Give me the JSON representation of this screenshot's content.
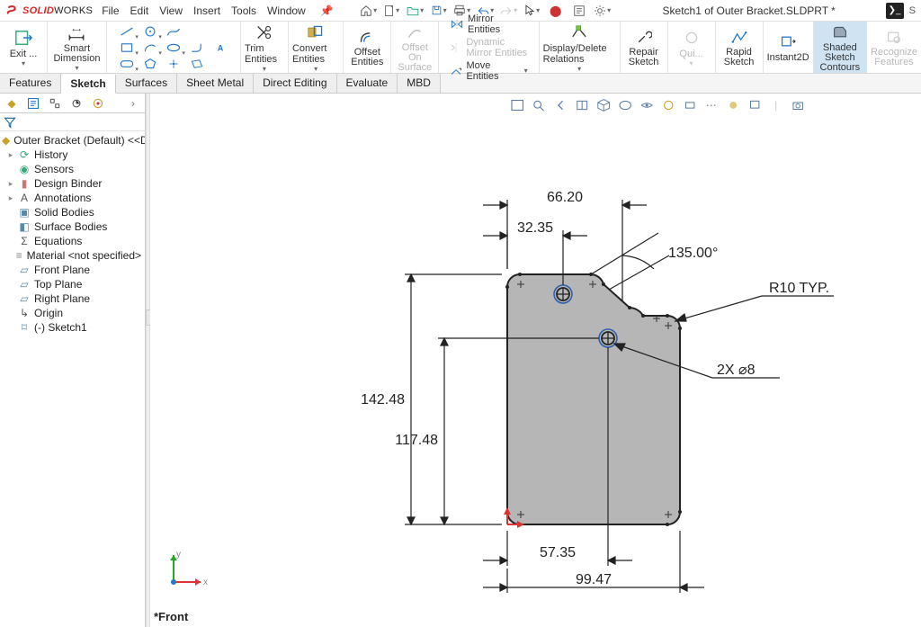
{
  "brand": {
    "solid": "SOLID",
    "works": "WORKS"
  },
  "menubar": [
    "File",
    "Edit",
    "View",
    "Insert",
    "Tools",
    "Window"
  ],
  "title": "Sketch1 of Outer Bracket.SLDPRT *",
  "search_placeholder": "Search",
  "ribbon": {
    "exit": "Exit ...",
    "smart_dim": "Smart Dimension",
    "trim": "Trim Entities",
    "convert": "Convert Entities",
    "offset": "Offset",
    "offset2": "Entities",
    "offset_on": "Offset On",
    "surface": "Surface",
    "mirror": "Mirror Entities",
    "dyn_mirror": "Dynamic Mirror Entities",
    "move": "Move Entities",
    "disp_del": "Display/Delete Relations",
    "repair": "Repair",
    "repair2": "Sketch",
    "quick": "Qui...",
    "rapid": "Rapid",
    "rapid2": "Sketch",
    "instant": "Instant2D",
    "shaded": "Shaded Sketch",
    "shaded2": "Contours",
    "recog": "Recognize",
    "recog2": "Features"
  },
  "cmdtabs": [
    "Features",
    "Sketch",
    "Surfaces",
    "Sheet Metal",
    "Direct Editing",
    "Evaluate",
    "MBD"
  ],
  "tree": {
    "root": "Outer Bracket (Default) <<Def",
    "items": [
      "History",
      "Sensors",
      "Design Binder",
      "Annotations",
      "Solid Bodies",
      "Surface Bodies",
      "Equations",
      "Material <not specified>",
      "Front Plane",
      "Top Plane",
      "Right Plane",
      "Origin",
      "(-) Sketch1"
    ]
  },
  "dims": {
    "d_top_w": "66.20",
    "d_hole_x": "32.35",
    "d_angle": "135.00°",
    "d_r": "R10 TYP.",
    "d_dia": "2X ⌀8",
    "d_h1": "142.48",
    "d_h2": "117.48",
    "d_off": "57.35",
    "d_bot_w": "99.47"
  },
  "viewlabel": "*Front",
  "search_btn": "S"
}
